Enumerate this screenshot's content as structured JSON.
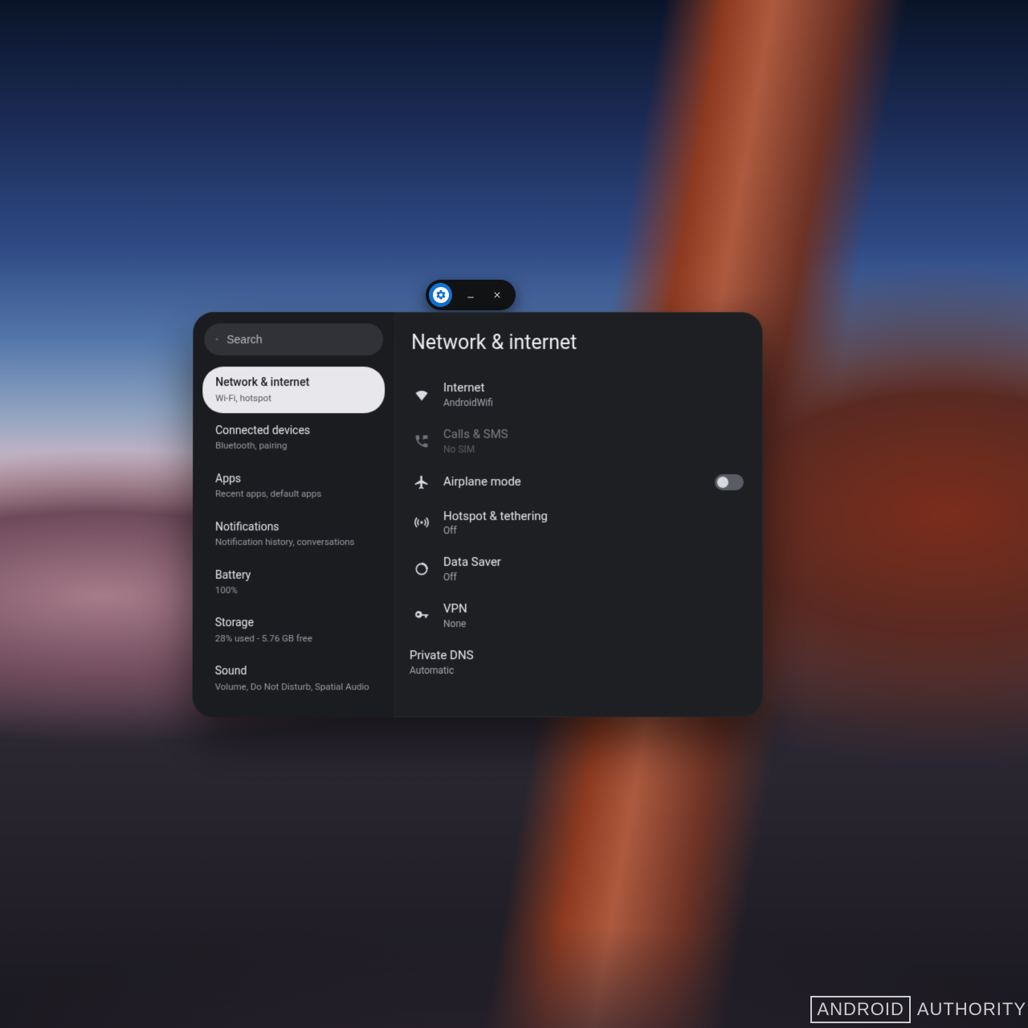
{
  "window_controls": {
    "app_icon": "settings-gear",
    "minimize_label": "Minimize",
    "close_label": "Close"
  },
  "search": {
    "placeholder": "Search",
    "value": ""
  },
  "sidebar": {
    "items": [
      {
        "title": "Network & internet",
        "subtitle": "Wi-Fi, hotspot",
        "active": true
      },
      {
        "title": "Connected devices",
        "subtitle": "Bluetooth, pairing",
        "active": false
      },
      {
        "title": "Apps",
        "subtitle": "Recent apps, default apps",
        "active": false
      },
      {
        "title": "Notifications",
        "subtitle": "Notification history, conversations",
        "active": false
      },
      {
        "title": "Battery",
        "subtitle": "100%",
        "active": false
      },
      {
        "title": "Storage",
        "subtitle": "28% used - 5.76 GB free",
        "active": false
      },
      {
        "title": "Sound",
        "subtitle": "Volume, Do Not Disturb, Spatial Audio",
        "active": false
      }
    ]
  },
  "main": {
    "title": "Network & internet",
    "items": {
      "internet": {
        "title": "Internet",
        "subtitle": "AndroidWifi",
        "icon": "wifi"
      },
      "calls_sms": {
        "title": "Calls & SMS",
        "subtitle": "No SIM",
        "icon": "phone-sms",
        "disabled": true
      },
      "airplane": {
        "title": "Airplane mode",
        "icon": "airplane",
        "toggle": false
      },
      "hotspot": {
        "title": "Hotspot & tethering",
        "subtitle": "Off",
        "icon": "hotspot"
      },
      "datasaver": {
        "title": "Data Saver",
        "subtitle": "Off",
        "icon": "data-saver"
      },
      "vpn": {
        "title": "VPN",
        "subtitle": "None",
        "icon": "vpn-key"
      },
      "privatedns": {
        "title": "Private DNS",
        "subtitle": "Automatic"
      }
    }
  },
  "watermark": {
    "boxed": "ANDROID",
    "rest": "AUTHORITY"
  }
}
